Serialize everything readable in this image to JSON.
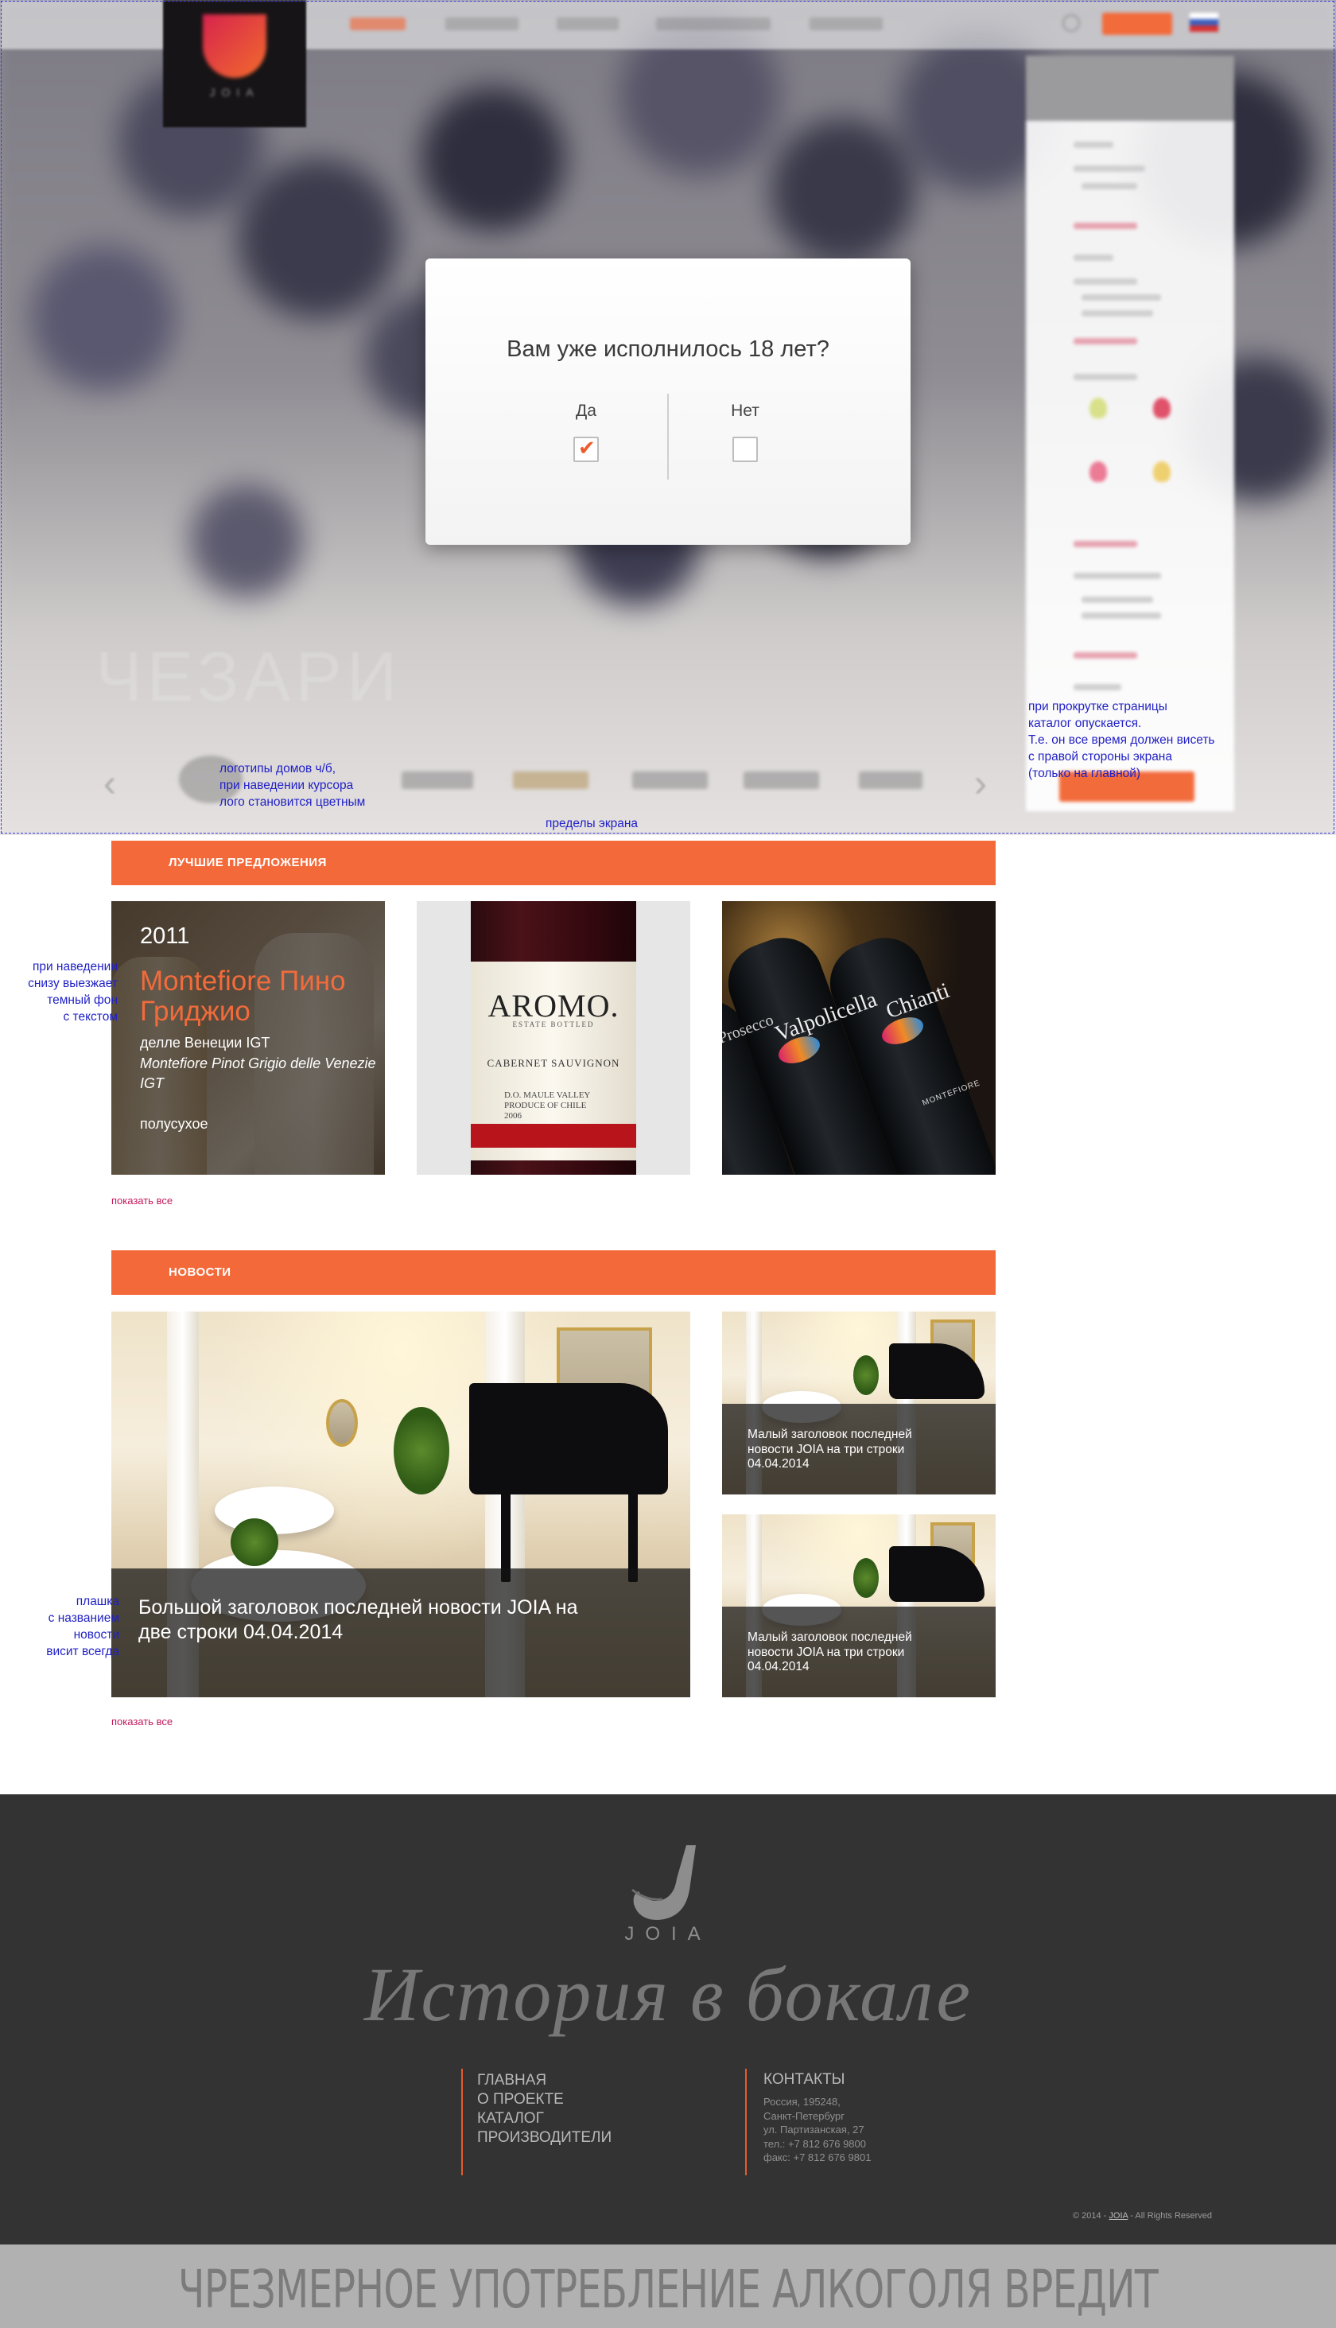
{
  "header": {
    "logo_text": "JOIA",
    "nav": [
      "",
      "",
      "",
      "",
      ""
    ]
  },
  "hero": {
    "watermark": "ЧЕЗАРИ"
  },
  "age_modal": {
    "question": "Вам уже исполнилось 18 лет?",
    "yes_label": "Да",
    "no_label": "Нет",
    "yes_checked": true,
    "no_checked": false
  },
  "annotations": {
    "brands_note_1": "логотипы домов ч/б,",
    "brands_note_2": "при наведении курсора",
    "brands_note_3": "лого становится цветным",
    "screen_bounds": "пределы экрана",
    "catalog_note_1": "при прокрутке страницы",
    "catalog_note_2": "каталог опускается.",
    "catalog_note_3": "Т.е. он все время должен висеть",
    "catalog_note_4": "с правой стороны экрана",
    "catalog_note_5": "(только на главной)",
    "offer_note_1": "при наведении",
    "offer_note_2": "снизу выезжает",
    "offer_note_3": "темный фон",
    "offer_note_4": "с текстом",
    "news_note_1": "плашка",
    "news_note_2": "с названием",
    "news_note_3": "новости",
    "news_note_4": "висит всегда"
  },
  "offers": {
    "title": "ЛУЧШИЕ ПРЕДЛОЖЕНИЯ",
    "show_all": "показать все",
    "featured": {
      "year": "2011",
      "name": "Montefiore Пино Гриджио",
      "subtitle_ru": "делле Венеции IGT",
      "subtitle_orig": "Montefiore Pinot Grigio delle Venezie IGT",
      "type": "полусухое"
    },
    "bottle2": {
      "brand": "AROMO.",
      "estate": "ESTATE BOTTLED",
      "variety": "CABERNET SAUVIGNON",
      "region_1": "D.O. MAULE VALLEY",
      "region_2": "PRODUCE OF CHILE",
      "region_3": "2006"
    },
    "bottle3": {
      "label_a": "Valpolicella",
      "label_b": "Chianti",
      "label_c": "Prosecco",
      "maker": "MONTEFIORE"
    }
  },
  "news": {
    "title": "НОВОСТИ",
    "show_all": "показать все",
    "big_caption": "Большой заголовок последней новости JOIA на две строки 04.04.2014",
    "small_1": "Малый заголовок последней новости JOIA на три строки 04.04.2014",
    "small_2": "Малый заголовок последней новости JOIA на три строки 04.04.2014"
  },
  "footer": {
    "logo_text": "JOIA",
    "slogan": "История в бокале",
    "nav": [
      "ГЛАВНАЯ",
      "О ПРОЕКТЕ",
      "КАТАЛОГ",
      "ПРОИЗВОДИТЕЛИ"
    ],
    "contacts_title": "КОНТАКТЫ",
    "contacts": [
      "Россия, 195248,",
      "Санкт-Петербург",
      "ул. Партизанская, 27",
      "тел.: +7 812 676 9800",
      "факс: +7 812 676 9801"
    ],
    "copyright_pre": "© 2014 - ",
    "copyright_brand": "JOIA",
    "copyright_post": " - All Rights Reserved"
  },
  "warning": "ЧРЕЗМЕРНОЕ УПОТРЕБЛЕНИЕ АЛКОГОЛЯ ВРЕДИТ ВАШЕМУ ЗДОРОВЬЮ",
  "colors": {
    "accent": "#f4693a",
    "link": "#c2185b",
    "footer_bg": "#333333",
    "annotation": "#1f1fc6"
  }
}
